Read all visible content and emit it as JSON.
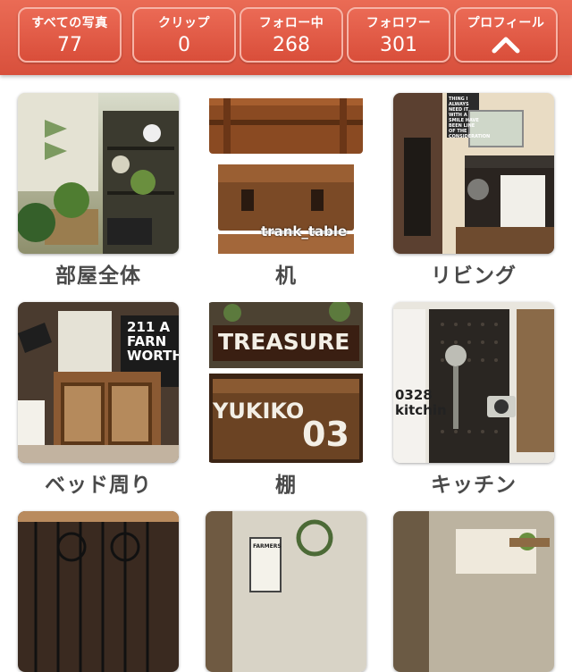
{
  "header": {
    "stats": [
      {
        "label": "すべての写真",
        "value": "77"
      },
      {
        "label": "クリップ",
        "value": "0"
      },
      {
        "label": "フォロー中",
        "value": "268"
      },
      {
        "label": "フォロワー",
        "value": "301"
      }
    ],
    "profile_label": "プロフィール",
    "colors": {
      "bar": "#d8503c",
      "button_border": "#f7b3a6"
    }
  },
  "categories": [
    {
      "label": "部屋全体",
      "photo_text": ""
    },
    {
      "label": "机",
      "photo_text": "trank_table"
    },
    {
      "label": "リビング",
      "photo_text": "THING I ALWAYS NEED IT WITH A SMILE HAVE BEEN LINE OF THE CONSIDERATION"
    },
    {
      "label": "ベッド周り",
      "photo_text": "211 A FARN WORTH"
    },
    {
      "label": "棚",
      "photo_text": "TREASURE"
    },
    {
      "label": "キッチン",
      "photo_text": "0328 kitchin"
    },
    {
      "label": "",
      "photo_text": ""
    },
    {
      "label": "",
      "photo_text": "FARMERS"
    },
    {
      "label": "",
      "photo_text": ""
    }
  ],
  "extra_text": {
    "trunk2": "YUKIKO",
    "trunk2_num": "03",
    "shelf_sign": "TREASURE"
  }
}
